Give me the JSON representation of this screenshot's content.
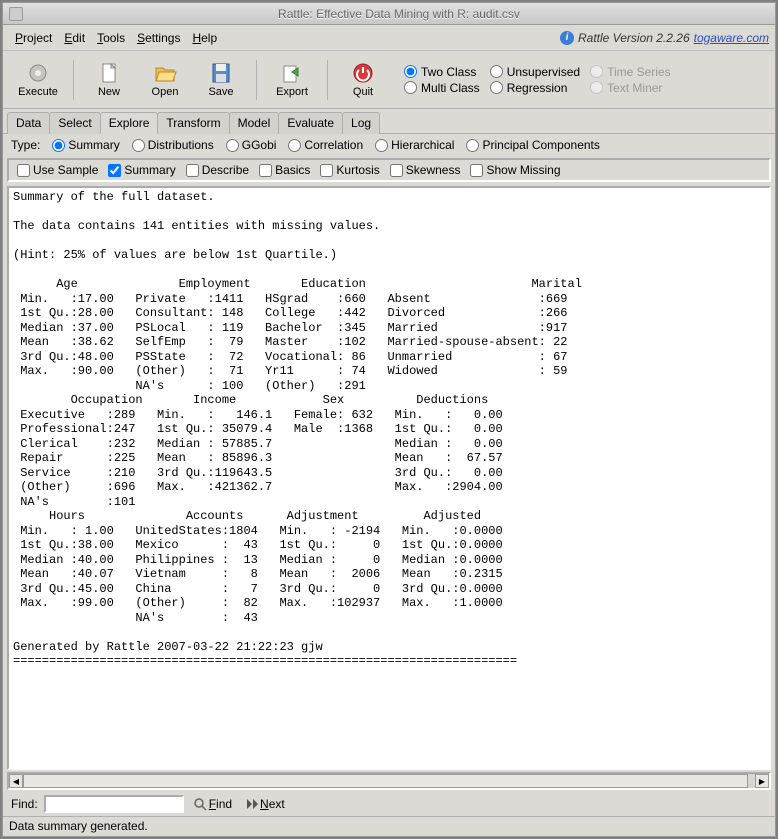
{
  "window": {
    "title": "Rattle: Effective Data Mining with R: audit.csv"
  },
  "menubar": {
    "items": [
      "Project",
      "Edit",
      "Tools",
      "Settings",
      "Help"
    ],
    "version_prefix": "Rattle Version 2.2.26",
    "link": "togaware.com"
  },
  "toolbar": {
    "execute": "Execute",
    "new": "New",
    "open": "Open",
    "save": "Save",
    "export": "Export",
    "quit": "Quit"
  },
  "data_type_radios": {
    "two_class": "Two Class",
    "unsupervised": "Unsupervised",
    "time_series": "Time Series",
    "multi_class": "Multi Class",
    "regression": "Regression",
    "text_miner": "Text Miner"
  },
  "tabs": [
    "Data",
    "Select",
    "Explore",
    "Transform",
    "Model",
    "Evaluate",
    "Log"
  ],
  "type_row": {
    "label": "Type:",
    "options": [
      "Summary",
      "Distributions",
      "GGobi",
      "Correlation",
      "Hierarchical",
      "Principal Components"
    ]
  },
  "check_row": {
    "use_sample": "Use Sample",
    "summary": "Summary",
    "describe": "Describe",
    "basics": "Basics",
    "kurtosis": "Kurtosis",
    "skewness": "Skewness",
    "show_missing": "Show Missing"
  },
  "find": {
    "label": "Find:",
    "find_btn": "Find",
    "next_btn": "Next"
  },
  "status": "Data summary generated.",
  "output": "Summary of the full dataset.\n\nThe data contains 141 entities with missing values.\n\n(Hint: 25% of values are below 1st Quartile.)\n\n      Age              Employment       Education                       Marital    \n Min.   :17.00   Private   :1411   HSgrad    :660   Absent               :669  \n 1st Qu.:28.00   Consultant: 148   College   :442   Divorced             :266  \n Median :37.00   PSLocal   : 119   Bachelor  :345   Married              :917  \n Mean   :38.62   SelfEmp   :  79   Master    :102   Married-spouse-absent: 22  \n 3rd Qu.:48.00   PSState   :  72   Vocational: 86   Unmarried            : 67  \n Max.   :90.00   (Other)   :  71   Yr11      : 74   Widowed              : 59  \n                 NA's      : 100   (Other)   :291                              \n        Occupation       Income            Sex          Deductions     \n Executive   :289   Min.   :   146.1   Female: 632   Min.   :   0.00  \n Professional:247   1st Qu.: 35079.4   Male  :1368   1st Qu.:   0.00  \n Clerical    :232   Median : 57885.7                 Median :   0.00  \n Repair      :225   Mean   : 85896.3                 Mean   :  67.57  \n Service     :210   3rd Qu.:119643.5                 3rd Qu.:   0.00  \n (Other)     :696   Max.   :421362.7                 Max.   :2904.00  \n NA's        :101                                                     \n     Hours              Accounts      Adjustment         Adjusted     \n Min.   : 1.00   UnitedStates:1804   Min.   : -2194   Min.   :0.0000  \n 1st Qu.:38.00   Mexico      :  43   1st Qu.:     0   1st Qu.:0.0000  \n Median :40.00   Philippines :  13   Median :     0   Median :0.0000  \n Mean   :40.07   Vietnam     :   8   Mean   :  2006   Mean   :0.2315  \n 3rd Qu.:45.00   China       :   7   3rd Qu.:     0   3rd Qu.:0.0000  \n Max.   :99.00   (Other)     :  82   Max.   :102937   Max.   :1.0000  \n                 NA's        :  43                                    \n\nGenerated by Rattle 2007-03-22 21:22:23 gjw\n======================================================================"
}
